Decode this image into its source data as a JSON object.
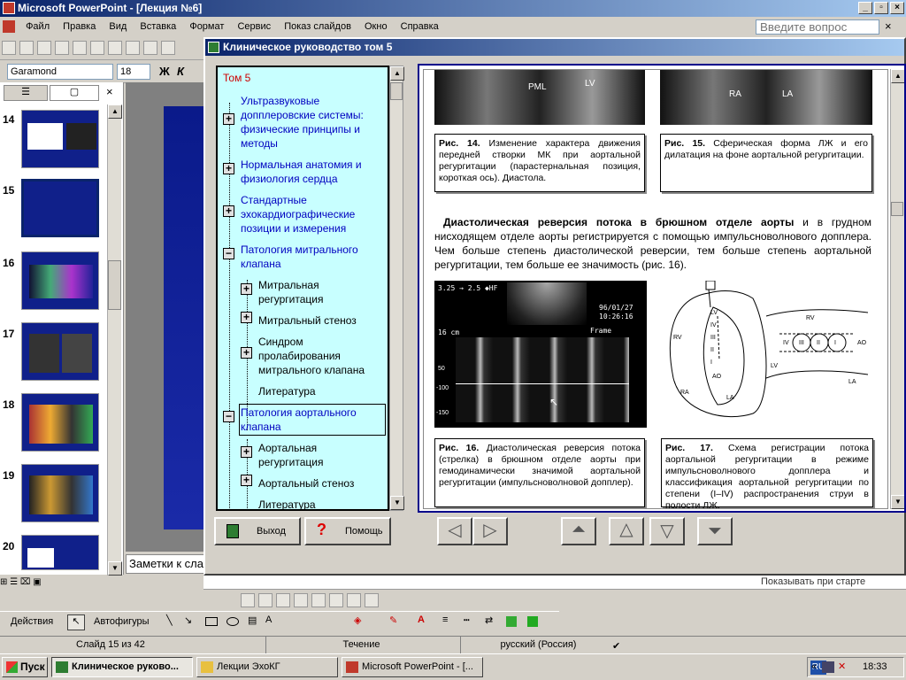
{
  "app": {
    "title": "Microsoft PowerPoint - [Лекция №6]",
    "menu": [
      "Файл",
      "Правка",
      "Вид",
      "Вставка",
      "Формат",
      "Сервис",
      "Показ слайдов",
      "Окно",
      "Справка"
    ],
    "ask_placeholder": "Введите вопрос",
    "font_name": "Garamond",
    "font_size": "18",
    "bold_label": "Ж",
    "italic_label": "К",
    "notes_text": "Заметки к сла",
    "hint_text": "Показывать при старте"
  },
  "slides": {
    "numbers": [
      "14",
      "15",
      "16",
      "17",
      "18",
      "19",
      "20"
    ],
    "selected": "15"
  },
  "guide": {
    "title": "Клиническое руководство том 5",
    "toc_root": "Том 5",
    "toc": [
      {
        "label": "Ультразвуковые допплеровские системы: физические принципы и методы",
        "level": 0,
        "expander": "+"
      },
      {
        "label": "Нормальная анатомия и физиология сердца",
        "level": 0,
        "expander": "+"
      },
      {
        "label": "Стандартные эхокардиографические позиции и измерения",
        "level": 0,
        "expander": "+"
      },
      {
        "label": "Патология митрального клапана",
        "level": 0,
        "expander": "−"
      },
      {
        "label": "Митральная регургитация",
        "level": 1,
        "expander": "+"
      },
      {
        "label": "Митральный стеноз",
        "level": 1,
        "expander": "+"
      },
      {
        "label": "Синдром пролабирования митрального клапана",
        "level": 1,
        "expander": "+"
      },
      {
        "label": "Литература",
        "level": 1,
        "expander": ""
      },
      {
        "label": "Патология аортального клапана",
        "level": 0,
        "expander": "−"
      },
      {
        "label": "Аортальная регургитация",
        "level": 1,
        "expander": "+"
      },
      {
        "label": "Аортальный стеноз",
        "level": 1,
        "expander": "+"
      },
      {
        "label": "Литература",
        "level": 1,
        "expander": ""
      }
    ],
    "img14_labels": [
      "PML",
      "LV"
    ],
    "img15_labels": [
      "RA",
      "LA"
    ],
    "fig14_num": "Рис. 14.",
    "fig14_text": "Изменение характера движения передней створки МК при аортальной регургитации (парастернальная позиция, короткая ось). Диастола.",
    "fig15_num": "Рис. 15.",
    "fig15_text": "Сферическая форма ЛЖ и его дилатация на фоне аортальной регургитации.",
    "para_bold": "Диастолическая реверсия потока в брюшном отделе аорты",
    "para_text": " и в грудном нисходящем отделе аорты регистрируется с помощью импульсноволнового допплера. Чем больше степень диастолической реверсии, тем больше степень аортальной регургитации, тем больше ее значимость (рис. 16).",
    "doppler_header": "3.25 → 2.5  ◆HF",
    "doppler_date": "96/01/27",
    "doppler_time": "10:26:16",
    "doppler_depth": "16 cm",
    "doppler_frame": "Frame",
    "doppler_ticks": [
      "50",
      "-100",
      "-150"
    ],
    "diag_labels": [
      "RV",
      "LV",
      "IV",
      "III",
      "II",
      "I",
      "AO",
      "RA",
      "LA"
    ],
    "diag2_labels": [
      "RV",
      "IV",
      "III",
      "II",
      "I",
      "AO",
      "LV",
      "LA"
    ],
    "fig16_num": "Рис. 16.",
    "fig16_text": "Диастолическая реверсия потока (стрелка) в брюшном отделе аорты при гемодинамически значимой аортальной регургитации (импульсноволновой допплер).",
    "fig17_num": "Рис. 17.",
    "fig17_text": "Схема регистрации потока аортальной регургитации в режиме импульсноволнового допплера и классификация аортальной регургитации по степени (I–IV) распространения струи в полости ЛЖ.",
    "exit_label": "Выход",
    "help_label": "Помощь"
  },
  "draw": {
    "actions_label": "Действия",
    "autoshapes_label": "Автофигуры"
  },
  "status": {
    "slide": "Слайд 15 из 42",
    "design": "Течение",
    "language": "русский (Россия)"
  },
  "taskbar": {
    "start": "Пуск",
    "tasks": [
      "Клиническое руково...",
      "Лекции ЭхоКГ",
      "Microsoft PowerPoint - [..."
    ],
    "lang": "RU",
    "time": "18:33"
  },
  "colors": {
    "toc_bg": "#c8ffff",
    "accent": "#0a246a",
    "link": "#0000c0"
  }
}
